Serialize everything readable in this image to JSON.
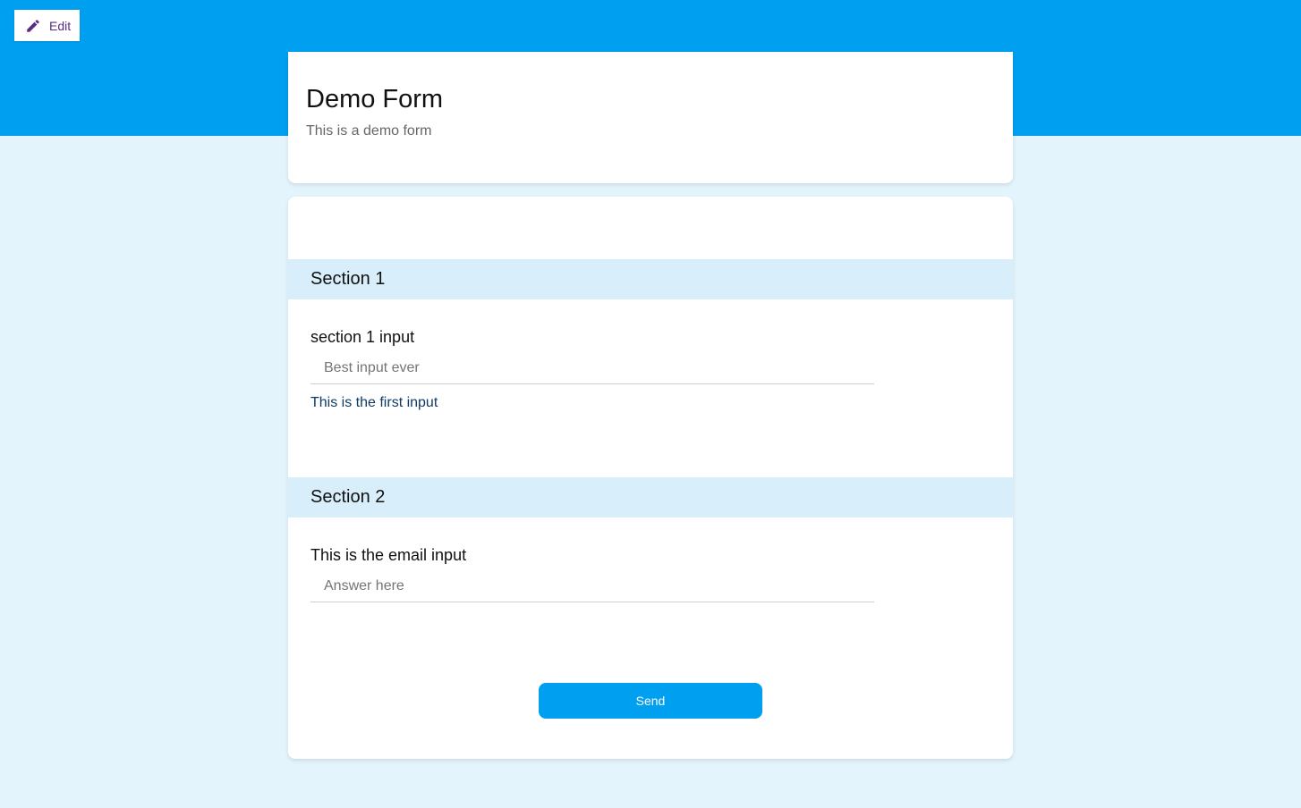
{
  "toolbar": {
    "edit_label": "Edit",
    "edit_icon": "pencil-icon"
  },
  "colors": {
    "primary": "#009fef",
    "background": "#e3f4fc",
    "section_header": "#d8eefb",
    "edit_label": "#5b2c83",
    "helper_text": "#0d3b66"
  },
  "form": {
    "title": "Demo Form",
    "description": "This is a demo form"
  },
  "sections": [
    {
      "title": "Section 1",
      "field_label": "section 1 input",
      "placeholder": "Best input ever",
      "value": "",
      "helper": "This is the first input"
    },
    {
      "title": "Section 2",
      "field_label": "This is the email input",
      "placeholder": "Answer here",
      "value": ""
    }
  ],
  "submit": {
    "label": "Send"
  }
}
